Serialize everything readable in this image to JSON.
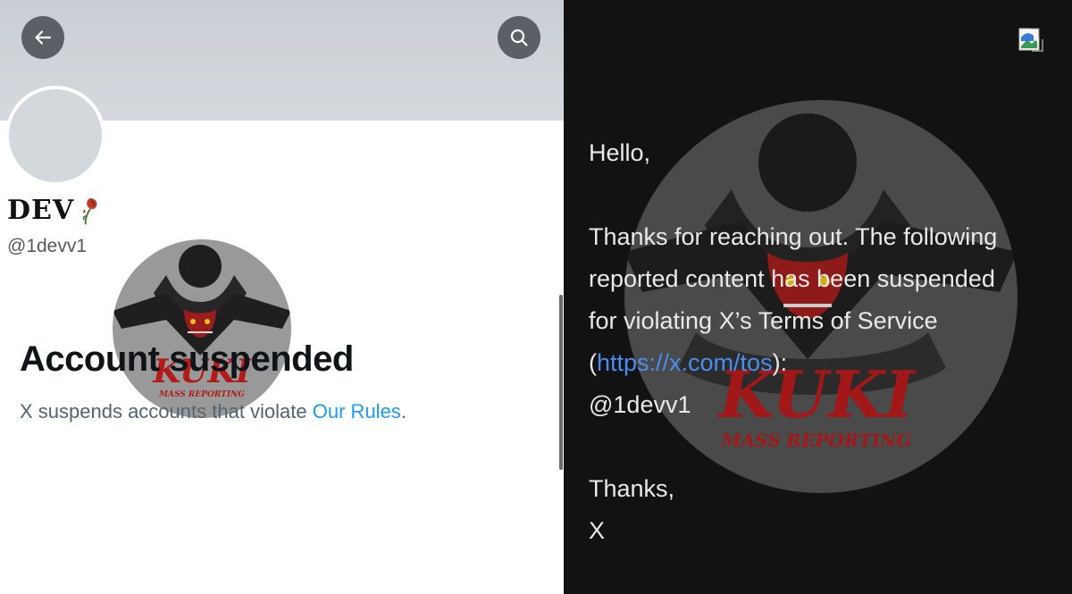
{
  "profile": {
    "name": "DEV",
    "handle": "@1devv1",
    "suspended_title": "Account suspended",
    "suspended_desc_prefix": "X suspends accounts that violate ",
    "rules_link": "Our Rules",
    "suspended_desc_suffix": "."
  },
  "watermark": {
    "line1": "KUKI",
    "line2": "MASS REPORTING"
  },
  "email": {
    "greeting": "Hello,",
    "line1": "Thanks for reaching out. The following",
    "line2": "reported content has been suspended",
    "line3": "for violating X’s Terms of Service",
    "paren_open": "(",
    "tos_link": "https://x.com/tos",
    "paren_close": "):",
    "handle": "@1devv1",
    "signoff": "Thanks,",
    "sender": "X"
  },
  "icons": {
    "back": "arrow-left-icon",
    "search": "search-icon",
    "rose": "wilted-rose-icon",
    "broken_image": "broken-image-icon"
  },
  "colors": {
    "link_blue": "#1d9bf0",
    "email_link": "#4a8df0",
    "dark_bg": "#121212"
  }
}
